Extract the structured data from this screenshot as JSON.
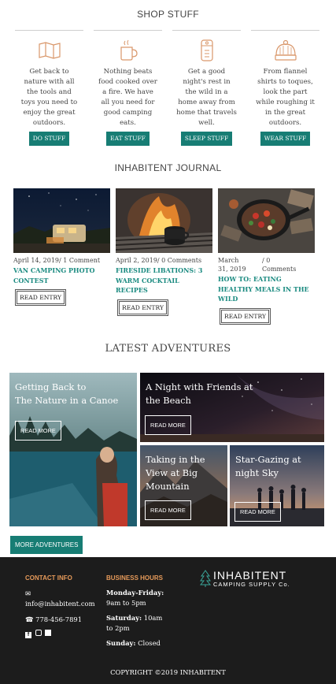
{
  "shop": {
    "title": "SHOP STUFF",
    "items": [
      {
        "icon": "map-icon",
        "desc": "Get back to nature with all the tools and toys you need to enjoy the great outdoors.",
        "button": "DO STUFF"
      },
      {
        "icon": "mug-icon",
        "desc": "Nothing beats food cooked over a fire. We have all you need for good camping eats.",
        "button": "EAT STUFF"
      },
      {
        "icon": "sleeping-bag-icon",
        "desc": "Get a good night's rest in the wild in a home away from home that travels well.",
        "button": "SLEEP STUFF"
      },
      {
        "icon": "toque-icon",
        "desc": "From flannel shirts to toques, look the part while roughing it in the great outdoors.",
        "button": "WEAR STUFF"
      }
    ]
  },
  "journal": {
    "title": "INHABITENT JOURNAL",
    "entries": [
      {
        "date": "April 14, 2019",
        "comments": "/ 1 Comment",
        "title": "VAN CAMPING PHOTO CONTEST",
        "button": "READ ENTRY",
        "image": "van-camping-photo"
      },
      {
        "date": "April 2, 2019",
        "comments": "/ 0 Comments",
        "title": "FIRESIDE LIBATIONS: 3 WARM COCKTAIL RECIPES",
        "button": "READ ENTRY",
        "image": "campfire-mug-photo"
      },
      {
        "date": "March 31, 2019",
        "comments": "/ 0 Comments",
        "title": "HOW TO: EATING HEALTHY MEALS IN THE WILD",
        "button": "READ ENTRY",
        "image": "skillet-meal-photo"
      }
    ]
  },
  "adventures": {
    "title": "LATEST ADVENTURES",
    "cards": [
      {
        "title_line1": "Getting Back to",
        "title_line2": "The Nature in a Canoe",
        "title_line3": "",
        "button": "READ MORE"
      },
      {
        "title_line1": "A Night with Friends at",
        "title_line2": "the Beach",
        "title_line3": "",
        "button": "READ MORE"
      },
      {
        "title_line1": "Taking in the",
        "title_line2": "View at Big",
        "title_line3": "Mountain",
        "button": "READ MORE"
      },
      {
        "title_line1": "Star-Gazing at",
        "title_line2": "night Sky",
        "title_line3": "",
        "button": "READ MORE"
      }
    ],
    "more_button": "MORE ADVENTURES"
  },
  "footer": {
    "contact_heading": "CONTACT INFO",
    "email": "info@inhabitent.com",
    "phone": "778-456-7891",
    "hours_heading": "BUSINESS HOURS",
    "hours": [
      {
        "day": "Monday-Friday:",
        "time": "9am to 5pm"
      },
      {
        "day": "Saturday:",
        "time": "10am to 2pm"
      },
      {
        "day": "Sunday:",
        "time": "Closed"
      }
    ],
    "logo_name": "INHABITENT",
    "logo_tagline": "CAMPING SUPPLY Co.",
    "copyright": "COPYRIGHT ©2019 INHABITENT",
    "social": [
      "facebook-icon",
      "instagram-icon",
      "twitter-icon"
    ]
  },
  "colors": {
    "accent": "#177d74",
    "link": "#1a8a80",
    "footer_heading": "#e69a5a",
    "icon": "#d9976a"
  }
}
